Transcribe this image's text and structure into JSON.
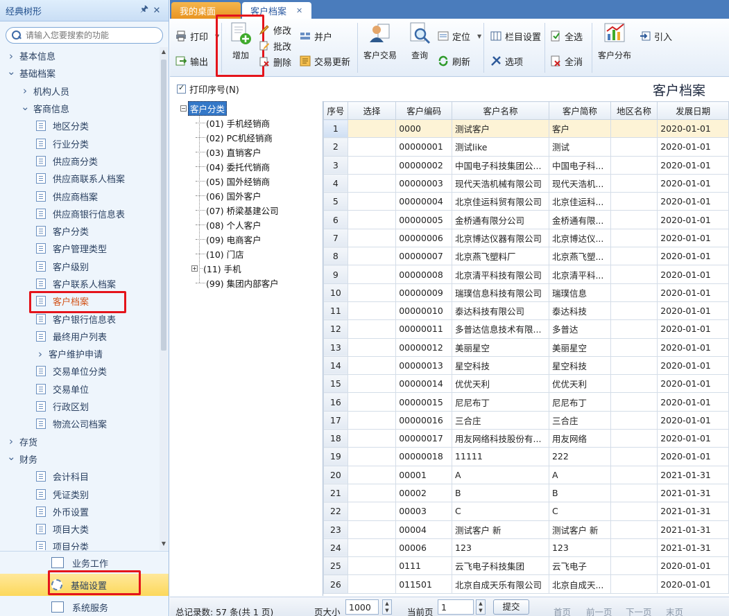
{
  "left_panel": {
    "title": "经典树形",
    "search_placeholder": "请输入您要搜索的功能",
    "nav": [
      {
        "level": 0,
        "expanded": false,
        "label": "基本信息"
      },
      {
        "level": 0,
        "expanded": true,
        "label": "基础档案"
      },
      {
        "level": 1,
        "expanded": false,
        "label": "机构人员"
      },
      {
        "level": 1,
        "expanded": true,
        "label": "客商信息"
      },
      {
        "level": 2,
        "label": "地区分类"
      },
      {
        "level": 2,
        "label": "行业分类"
      },
      {
        "level": 2,
        "label": "供应商分类"
      },
      {
        "level": 2,
        "label": "供应商联系人档案"
      },
      {
        "level": 2,
        "label": "供应商档案"
      },
      {
        "level": 2,
        "label": "供应商银行信息表"
      },
      {
        "level": 2,
        "label": "客户分类"
      },
      {
        "level": 2,
        "label": "客户管理类型"
      },
      {
        "level": 2,
        "label": "客户级别"
      },
      {
        "level": 2,
        "label": "客户联系人档案"
      },
      {
        "level": 2,
        "label": "客户档案",
        "active": true
      },
      {
        "level": 2,
        "label": "客户银行信息表"
      },
      {
        "level": 2,
        "label": "最终用户列表"
      },
      {
        "level": 1,
        "expanded": false,
        "label": "客户维护申请",
        "indent": true
      },
      {
        "level": 2,
        "label": "交易单位分类"
      },
      {
        "level": 2,
        "label": "交易单位"
      },
      {
        "level": 2,
        "label": "行政区划"
      },
      {
        "level": 2,
        "label": "物流公司档案"
      },
      {
        "level": 0,
        "expanded": false,
        "label": "存货"
      },
      {
        "level": 0,
        "expanded": true,
        "label": "财务"
      },
      {
        "level": 2,
        "label": "会计科目"
      },
      {
        "level": 2,
        "label": "凭证类别"
      },
      {
        "level": 2,
        "label": "外币设置"
      },
      {
        "level": 2,
        "label": "项目大类"
      },
      {
        "level": 2,
        "label": "项目分类"
      }
    ],
    "bottom_nav": [
      {
        "label": "业务工作",
        "icon": "business-icon"
      },
      {
        "label": "基础设置",
        "icon": "gear-icon",
        "selected": true
      },
      {
        "label": "系统服务",
        "icon": "service-icon"
      }
    ]
  },
  "tabs": [
    {
      "label": "我的桌面"
    },
    {
      "label": "客户档案",
      "close": "✕"
    }
  ],
  "toolbar": {
    "print": "打印",
    "export": "输出",
    "add": "增加",
    "modify": "修改",
    "batch_modify": "批改",
    "delete": "删除",
    "merge": "并户",
    "trade_update": "交易更新",
    "customer_trade": "客户交易",
    "query": "查询",
    "locate": "定位",
    "refresh": "刷新",
    "column_settings": "栏目设置",
    "options": "选项",
    "select_all": "全选",
    "deselect_all": "全消",
    "customer_distribution": "客户分布",
    "import": "引入"
  },
  "options_row": {
    "print_seq_label": "打印序号(N)",
    "page_title": "客户档案"
  },
  "tree": {
    "root": "客户分类",
    "children": [
      "(01) 手机经销商",
      "(02) PC机经销商",
      "(03) 直销客户",
      "(04) 委托代销商",
      "(05) 国外经销商",
      "(06) 国外客户",
      "(07) 桥梁基建公司",
      "(08) 个人客户",
      "(09) 电商客户",
      "(10) 门店",
      "(11) 手机",
      "(99) 集团内部客户"
    ]
  },
  "grid": {
    "columns": [
      "序号",
      "选择",
      "客户编码",
      "客户名称",
      "客户简称",
      "地区名称",
      "发展日期"
    ],
    "rows": [
      [
        "1",
        "",
        "0000",
        "测试客户",
        "客户",
        "",
        "2020-01-01"
      ],
      [
        "2",
        "",
        "00000001",
        "测试like",
        "测试",
        "",
        "2020-01-01"
      ],
      [
        "3",
        "",
        "00000002",
        "中国电子科技集团公...",
        "中国电子科...",
        "",
        "2020-01-01"
      ],
      [
        "4",
        "",
        "00000003",
        "现代天浩机械有限公司",
        "现代天浩机...",
        "",
        "2020-01-01"
      ],
      [
        "5",
        "",
        "00000004",
        "北京佳运科贸有限公司",
        "北京佳运科...",
        "",
        "2020-01-01"
      ],
      [
        "6",
        "",
        "00000005",
        "金桥通有限分公司",
        "金桥通有限...",
        "",
        "2020-01-01"
      ],
      [
        "7",
        "",
        "00000006",
        "北京博达仪器有限公司",
        "北京博达仪...",
        "",
        "2020-01-01"
      ],
      [
        "8",
        "",
        "00000007",
        "北京燕飞塑料厂",
        "北京燕飞塑...",
        "",
        "2020-01-01"
      ],
      [
        "9",
        "",
        "00000008",
        "北京清平科技有限公司",
        "北京清平科...",
        "",
        "2020-01-01"
      ],
      [
        "10",
        "",
        "00000009",
        "瑞璞信息科技有限公司",
        "瑞璞信息",
        "",
        "2020-01-01"
      ],
      [
        "11",
        "",
        "00000010",
        "泰达科技有限公司",
        "泰达科技",
        "",
        "2020-01-01"
      ],
      [
        "12",
        "",
        "00000011",
        "多普达信息技术有限...",
        "多普达",
        "",
        "2020-01-01"
      ],
      [
        "13",
        "",
        "00000012",
        "美丽星空",
        "美丽星空",
        "",
        "2020-01-01"
      ],
      [
        "14",
        "",
        "00000013",
        "星空科技",
        "星空科技",
        "",
        "2020-01-01"
      ],
      [
        "15",
        "",
        "00000014",
        "优优天利",
        "优优天利",
        "",
        "2020-01-01"
      ],
      [
        "16",
        "",
        "00000015",
        "尼尼布丁",
        "尼尼布丁",
        "",
        "2020-01-01"
      ],
      [
        "17",
        "",
        "00000016",
        "三合庄",
        "三合庄",
        "",
        "2020-01-01"
      ],
      [
        "18",
        "",
        "00000017",
        "用友网络科技股份有...",
        "用友网络",
        "",
        "2020-01-01"
      ],
      [
        "19",
        "",
        "00000018",
        "11111",
        "222",
        "",
        "2020-01-01"
      ],
      [
        "20",
        "",
        "00001",
        "A",
        "A",
        "",
        "2021-01-31"
      ],
      [
        "21",
        "",
        "00002",
        "B",
        "B",
        "",
        "2021-01-31"
      ],
      [
        "22",
        "",
        "00003",
        "C",
        "C",
        "",
        "2021-01-31"
      ],
      [
        "23",
        "",
        "00004",
        "测试客户 新",
        "测试客户 新",
        "",
        "2021-01-31"
      ],
      [
        "24",
        "",
        "00006",
        "123",
        "123",
        "",
        "2021-01-31"
      ],
      [
        "25",
        "",
        "0111",
        "云飞电子科技集团",
        "云飞电子",
        "",
        "2020-01-01"
      ],
      [
        "26",
        "",
        "011501",
        "北京自成天乐有限公司",
        "北京自成天...",
        "",
        "2020-01-01"
      ]
    ]
  },
  "status": {
    "total": "总记录数: 57 条(共 1 页)",
    "page_size_label": "页大小",
    "page_size": "1000",
    "current_page_label": "当前页",
    "current_page": "1",
    "submit": "提交",
    "first": "首页",
    "prev": "前一页",
    "next": "下一页",
    "last": "末页"
  },
  "colors": {
    "highlight_box": "#e4141b",
    "active_nav": "#d2541a",
    "tab_home": "#e89422",
    "tab_bar": "#4a7cbc"
  }
}
